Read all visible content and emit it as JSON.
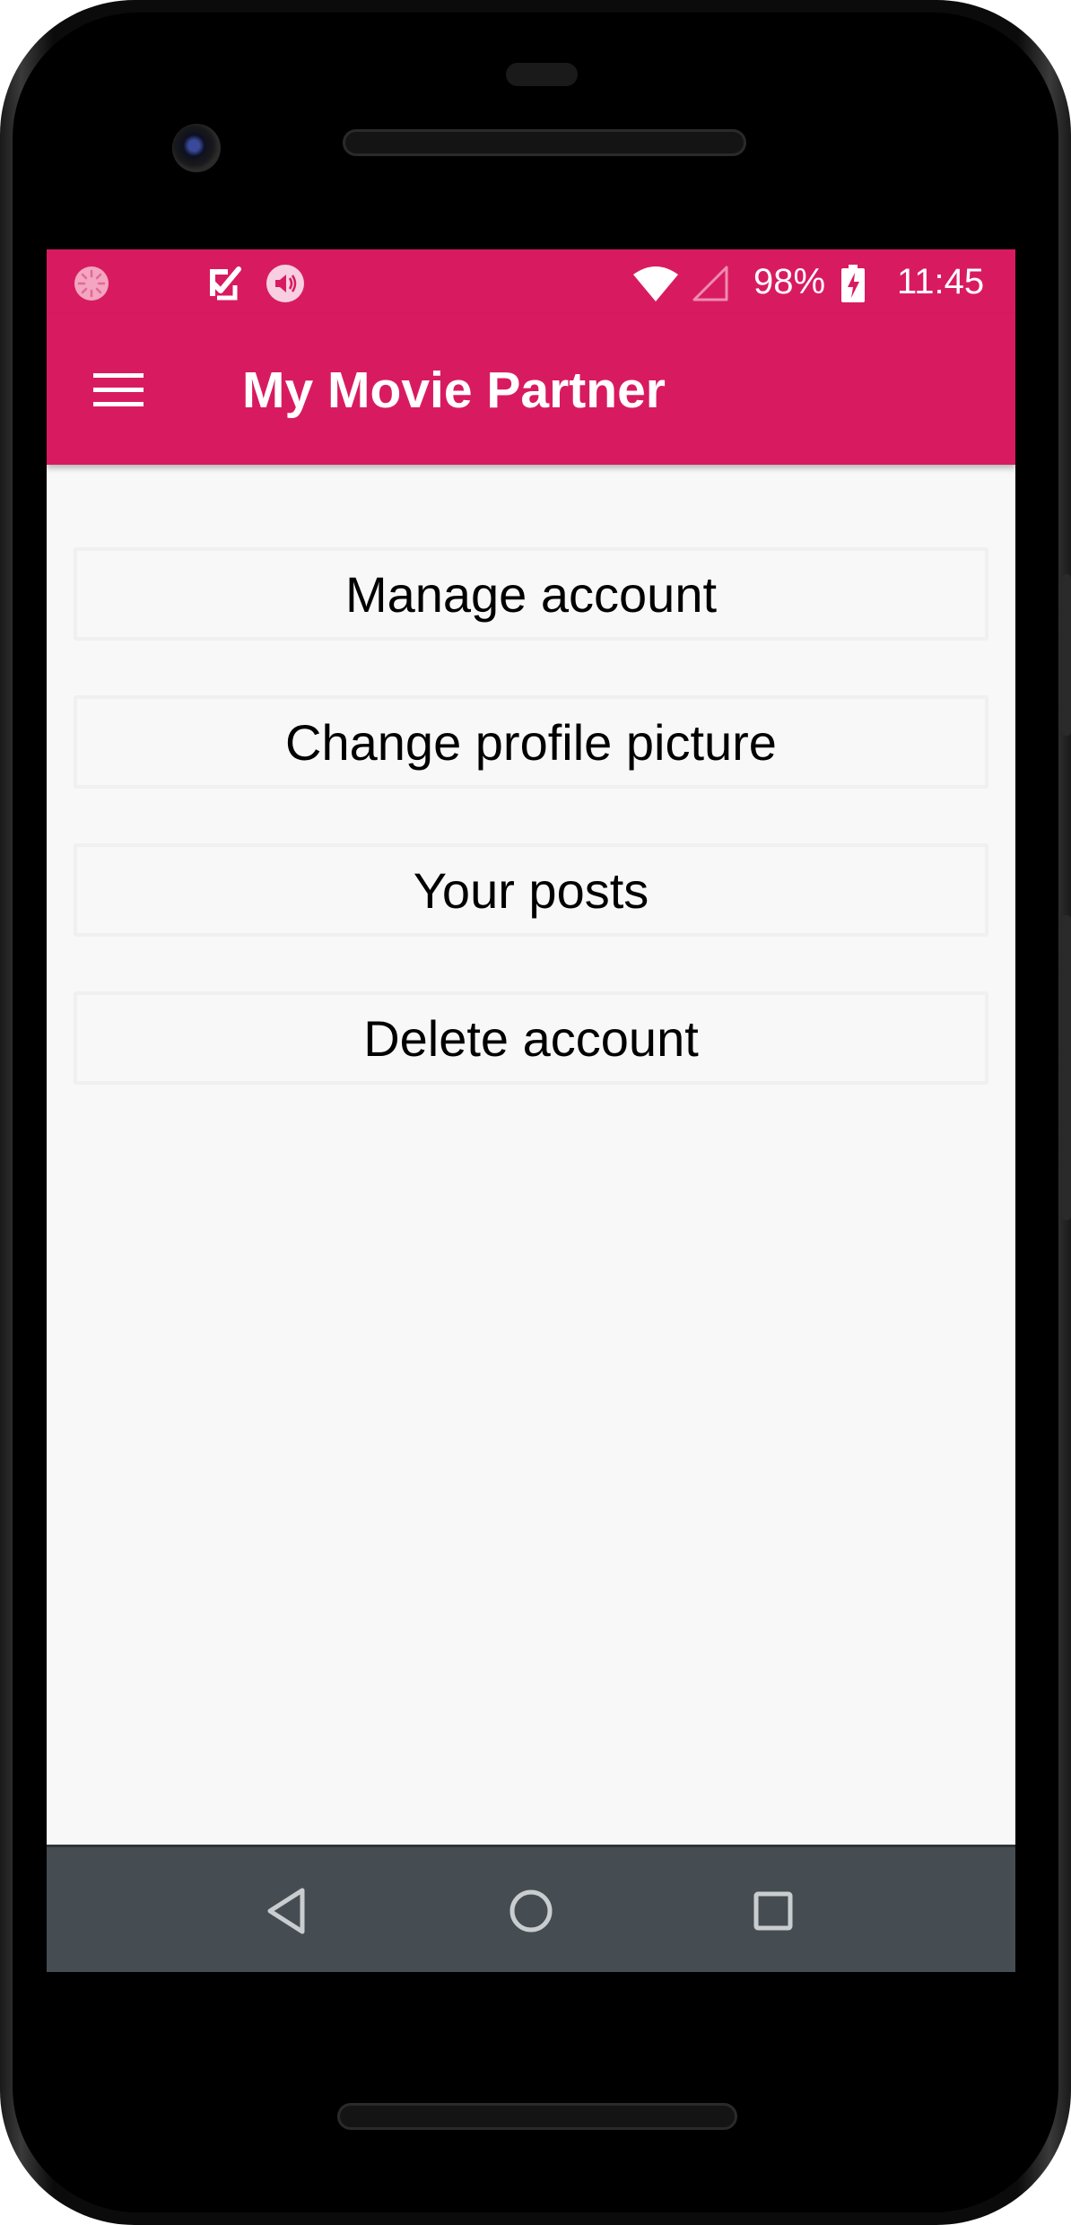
{
  "status_bar": {
    "battery_percent": "98%",
    "time": "11:45",
    "background_color": "#d81b60",
    "icons": [
      "loading-icon",
      "checkbox-notification-icon",
      "volume-icon",
      "wifi-icon",
      "cell-signal-icon",
      "battery-charging-icon"
    ]
  },
  "app_bar": {
    "title": "My Movie Partner",
    "menu_icon": "hamburger-menu-icon",
    "background_color": "#d81b60"
  },
  "menu": {
    "items": [
      {
        "label": "Manage account"
      },
      {
        "label": "Change profile picture"
      },
      {
        "label": "Your posts"
      },
      {
        "label": "Delete account"
      }
    ]
  },
  "navigation_bar": {
    "buttons": [
      "back-icon",
      "home-icon",
      "recents-icon"
    ],
    "background_color": "#454d52"
  }
}
